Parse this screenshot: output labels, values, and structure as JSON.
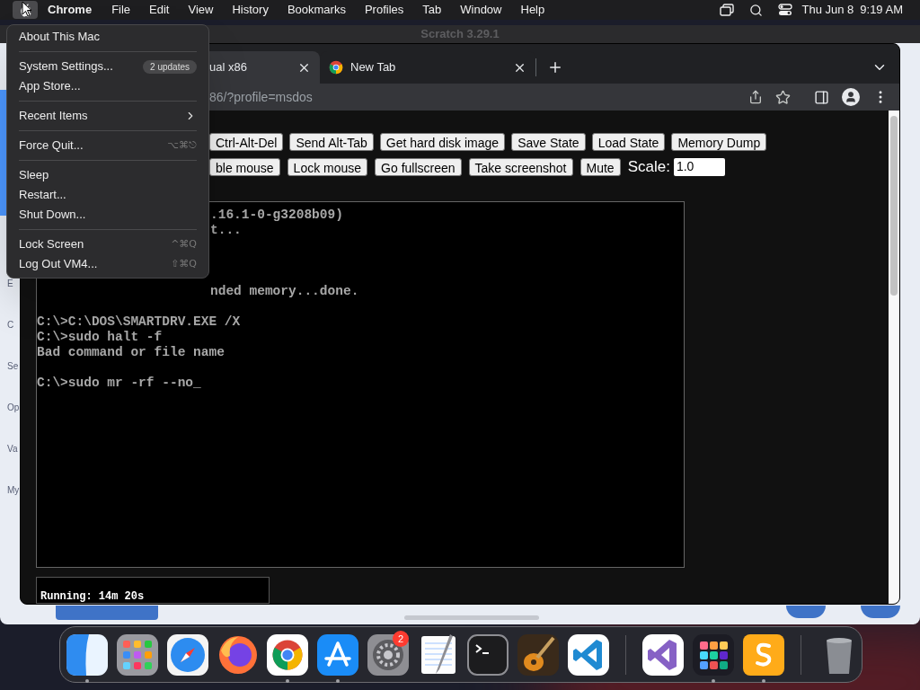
{
  "menu_bar": {
    "app": "Chrome",
    "apple_selected": true,
    "menus": [
      "File",
      "Edit",
      "View",
      "History",
      "Bookmarks",
      "Profiles",
      "Tab",
      "Window",
      "Help"
    ],
    "date": "Thu Jun 8",
    "time": "9:19 AM"
  },
  "background_window": {
    "title": "Scratch 3.29.1",
    "category_labels": [
      "E",
      "C",
      "Se",
      "Op",
      "Va",
      "My"
    ]
  },
  "browser": {
    "tabs": [
      {
        "title": "ual x86",
        "selected": true
      },
      {
        "title": "New Tab",
        "selected": false
      }
    ],
    "address": "86/?profile=msdos",
    "buttons_row_1": [
      "Ctrl-Alt-Del",
      "Send Alt-Tab",
      "Get hard disk image",
      "Save State",
      "Load State",
      "Memory Dump"
    ],
    "buttons_row_2": [
      "ble mouse",
      "Lock mouse",
      "Go fullscreen",
      "Take screenshot",
      "Mute"
    ],
    "scale_label": "Scale:",
    "scale_value": "1.0",
    "terminal_lines": [
      {
        "kind": "cut",
        "text": ".16.1-0-g3208b09)"
      },
      {
        "kind": "cut",
        "text": "t..."
      },
      {
        "kind": "blank"
      },
      {
        "kind": "blank"
      },
      {
        "kind": "blank"
      },
      {
        "kind": "cut",
        "text": "nded memory...done."
      },
      {
        "kind": "blank"
      },
      {
        "kind": "line",
        "text": "C:\\>C:\\DOS\\SMARTDRV.EXE /X"
      },
      {
        "kind": "line",
        "text": "C:\\>sudo halt -f"
      },
      {
        "kind": "line",
        "text": "Bad command or file name"
      },
      {
        "kind": "blank"
      },
      {
        "kind": "line",
        "text": "C:\\>sudo mr -rf --no_"
      }
    ],
    "status": "Running: 14m 20s"
  },
  "apple_menu": {
    "items": [
      {
        "kind": "item",
        "label": "About This Mac"
      },
      {
        "kind": "separator"
      },
      {
        "kind": "item",
        "label": "System Settings...",
        "badge": "2 updates"
      },
      {
        "kind": "item",
        "label": "App Store..."
      },
      {
        "kind": "separator"
      },
      {
        "kind": "submenu",
        "label": "Recent Items"
      },
      {
        "kind": "separator"
      },
      {
        "kind": "item",
        "label": "Force Quit...",
        "shortcut": "⌥⌘⎋"
      },
      {
        "kind": "separator"
      },
      {
        "kind": "item",
        "label": "Sleep"
      },
      {
        "kind": "item",
        "label": "Restart..."
      },
      {
        "kind": "item",
        "label": "Shut Down..."
      },
      {
        "kind": "separator"
      },
      {
        "kind": "item",
        "label": "Lock Screen",
        "shortcut": "^⌘Q"
      },
      {
        "kind": "item",
        "label": "Log Out VM4...",
        "shortcut": "⇧⌘Q"
      }
    ]
  },
  "dock": {
    "apps": [
      {
        "running": true
      },
      {
        "running": false
      },
      {
        "running": false
      },
      {
        "running": false
      },
      {
        "running": true
      },
      {
        "running": true
      },
      {
        "running": false,
        "badge": "2"
      },
      {
        "running": false
      },
      {
        "running": false
      },
      {
        "running": false
      },
      {
        "running": false
      },
      {
        "running": false
      },
      {
        "running": true
      },
      {
        "running": true
      },
      {
        "running": false
      }
    ]
  }
}
